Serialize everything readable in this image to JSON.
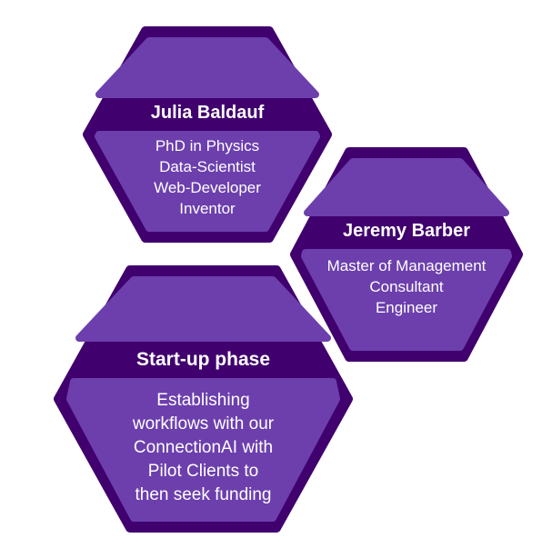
{
  "colors": {
    "border": "#40006e",
    "fill": "#6c3fad",
    "band": "#40006e",
    "text": "#ffffff",
    "background": "#ffffff"
  },
  "hexagons": [
    {
      "title": "Julia Baldauf",
      "lines": [
        "PhD in Physics",
        "Data-Scientist",
        "Web-Developer",
        "Inventor"
      ]
    },
    {
      "title": "Jeremy Barber",
      "lines": [
        "Master of Management",
        "Consultant",
        "Engineer"
      ]
    },
    {
      "title": "Start-up phase",
      "lines": [
        "Establishing",
        "workflows with our",
        "ConnectionAI with",
        "Pilot Clients to",
        "then seek funding"
      ]
    }
  ]
}
